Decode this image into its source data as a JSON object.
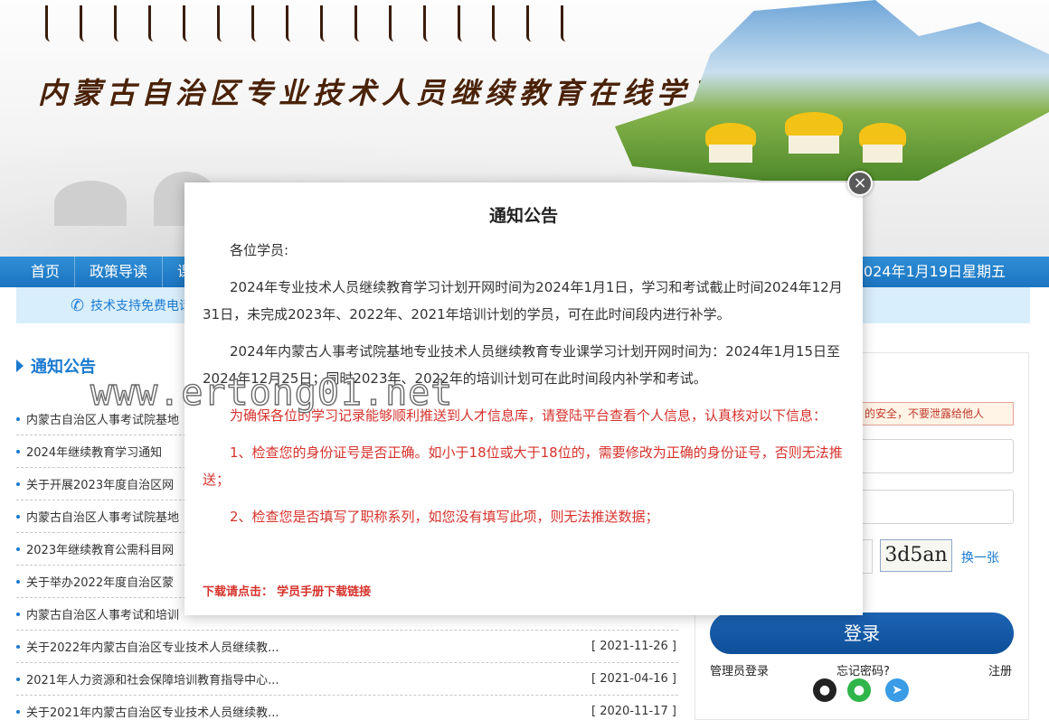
{
  "banner": {
    "site_title": "内蒙古自治区专业技术人员继续教育在线学习"
  },
  "nav": {
    "items": [
      "首页",
      "政策导读",
      "课"
    ],
    "date": "2024年1月19日星期五"
  },
  "support": {
    "text": "技术支持免费电话"
  },
  "notices": {
    "heading": "通知公告",
    "rows": [
      {
        "title": "内蒙古自治区人事考试院基地",
        "date": ""
      },
      {
        "title": "2024年继续教育学习通知",
        "date": ""
      },
      {
        "title": "关于开展2023年度自治区网",
        "date": ""
      },
      {
        "title": "内蒙古自治区人事考试院基地",
        "date": ""
      },
      {
        "title": "2023年继续教育公需科目网",
        "date": ""
      },
      {
        "title": "关于举办2022年度自治区蒙",
        "date": ""
      },
      {
        "title": "内蒙古自治区人事考试和培训",
        "date": ""
      },
      {
        "title": "关于2022年内蒙古自治区专业技术人员继续教...",
        "date": "[ 2021-11-26 ]"
      },
      {
        "title": "2021年人力资源和社会保障培训教育指导中心...",
        "date": "[ 2021-04-16 ]"
      },
      {
        "title": "关于2021年内蒙古自治区专业技术人员继续教...",
        "date": "[ 2020-11-17 ]"
      }
    ]
  },
  "login": {
    "warning": "的安全，不要泄露给他人",
    "captcha": "3d5an",
    "swap": "换一张",
    "button": "登录",
    "admin": "管理员登录",
    "forgot": "忘记密码?",
    "register": "注册"
  },
  "modal": {
    "title": "通知公告",
    "greeting": "各位学员:",
    "para1": "2024年专业技术人员继续教育学习计划开网时间为2024年1月1日，学习和考试截止时间2024年12月31日，未完成2023年、2022年、2021年培训计划的学员，可在此时间段内进行补学。",
    "para2": "2024年内蒙古人事考试院基地专业技术人员继续教育专业课学习计划开网时间为：2024年1月15日至2024年12月25日；同时2023年、2022年的培训计划可在此时间段内补学和考试。",
    "para3": "为确保各位的学习记录能够顺利推送到人才信息库，请登陆平台查看个人信息，认真核对以下信息：",
    "para4": "1、检查您的身份证号是否正确。如小于18位或大于18位的，需要修改为正确的身份证号，否则无法推送；",
    "para5": "2、检查您是否填写了职称系列，如您没有填写此项，则无法推送数据；",
    "download_label": "下载请点击：",
    "download_link": "学员手册下载链接",
    "close": "×"
  },
  "watermark": "www.ertong01.net",
  "colors": {
    "accent": "#1a7ad0",
    "nav": "#1b74c0",
    "alert": "#d6322c",
    "login_button": "#0e4f98"
  }
}
